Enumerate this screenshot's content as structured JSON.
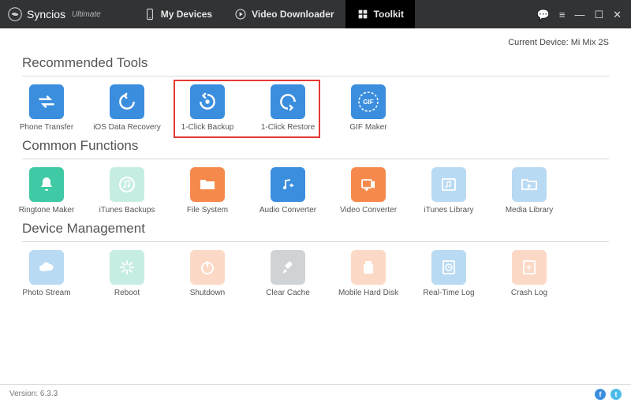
{
  "app": {
    "name": "Syncios",
    "edition": "Ultimate"
  },
  "nav": {
    "devices": "My Devices",
    "video": "Video Downloader",
    "toolkit": "Toolkit"
  },
  "current_device_label": "Current Device:",
  "current_device": "Mi Mix 2S",
  "sections": {
    "recommended": "Recommended Tools",
    "common": "Common Functions",
    "device": "Device Management"
  },
  "tools": {
    "phone_transfer": "Phone Transfer",
    "ios_recovery": "iOS Data Recovery",
    "one_click_backup": "1-Click Backup",
    "one_click_restore": "1-Click Restore",
    "gif_maker": "GIF Maker",
    "ringtone_maker": "Ringtone Maker",
    "itunes_backups": "iTunes Backups",
    "file_system": "File System",
    "audio_converter": "Audio Converter",
    "video_converter": "Video Converter",
    "itunes_library": "iTunes Library",
    "media_library": "Media Library",
    "photo_stream": "Photo Stream",
    "reboot": "Reboot",
    "shutdown": "Shutdown",
    "clear_cache": "Clear Cache",
    "mobile_hard_disk": "Mobile Hard Disk",
    "realtime_log": "Real-Time Log",
    "crash_log": "Crash Log"
  },
  "colors": {
    "blue": "#3b8ede",
    "blue_light": "#b9daf3",
    "green": "#3fc9a5",
    "green_light": "#c6ede4",
    "orange": "#f68a4d",
    "orange_light": "#fcd9c6",
    "gray_light": "#cfd3d6"
  },
  "footer": {
    "version_label": "Version:",
    "version": "6.3.3"
  }
}
